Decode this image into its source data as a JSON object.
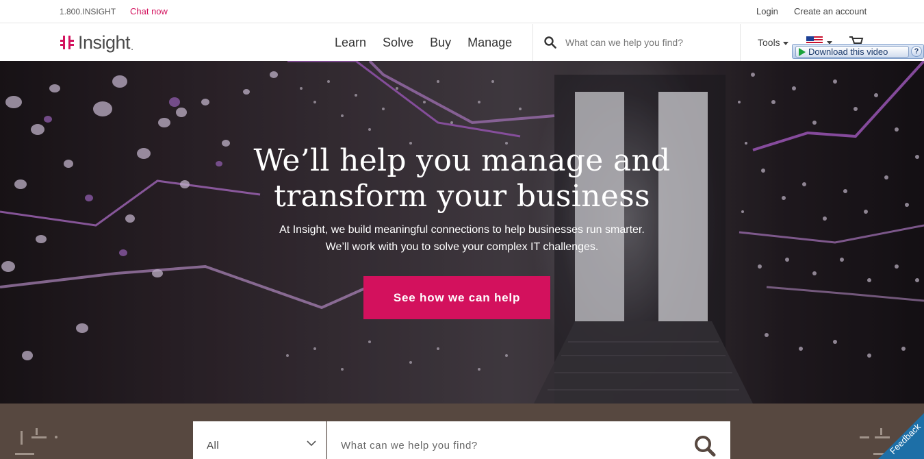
{
  "utility_bar": {
    "phone": "1.800.INSIGHT",
    "chat": "Chat now",
    "login": "Login",
    "create_account": "Create an account"
  },
  "header": {
    "logo_text": "Insight",
    "logo_dot": ".",
    "nav": [
      "Learn",
      "Solve",
      "Buy",
      "Manage"
    ],
    "search_placeholder": "What can we help you find?",
    "tools": "Tools",
    "flag_icon": "us-flag-icon",
    "cart_icon": "cart-icon"
  },
  "download_bar": {
    "label": "Download this video",
    "help": "?"
  },
  "hero": {
    "title_line1": "We’ll help you manage and",
    "title_line2": "transform your business",
    "subtitle_line1": "At Insight, we build meaningful connections to help businesses run smarter.",
    "subtitle_line2": "We’ll work with you to solve your complex IT challenges.",
    "cta": "See how we can help"
  },
  "search_band": {
    "category": "All",
    "placeholder": "What can we help you find?"
  },
  "feedback": "Feedback",
  "colors": {
    "brand_pink": "#d3115d",
    "band_brown": "#574840",
    "feedback_blue": "#1d6fa7"
  }
}
